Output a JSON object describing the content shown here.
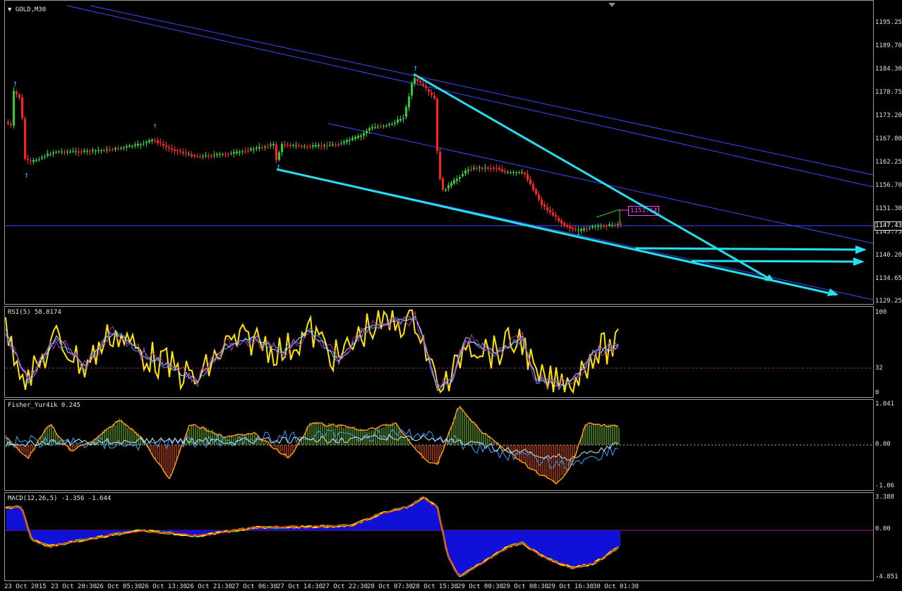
{
  "window": {
    "symbol_label": "GOLD,M30"
  },
  "colors": {
    "bull": "#2bd12b",
    "bear": "#ff2020",
    "trend": "#22e0f0",
    "channel": "#3a4cff",
    "rsi": "#ffe600",
    "magenta": "#ff40ff"
  },
  "main_pane": {
    "price_ticks": [
      "1195.25",
      "1189.70",
      "1184.30",
      "1178.75",
      "1173.20",
      "1167.80",
      "1162.25",
      "1156.70",
      "1151.30",
      "1145.75",
      "1140.20",
      "1134.65",
      "1129.25"
    ],
    "current_price": "1147.43",
    "price_tag": "1151.14"
  },
  "rsi_pane": {
    "label": "RSI(5) 58.8174",
    "ticks": [
      "100",
      "32",
      "0"
    ]
  },
  "fisher_pane": {
    "label": "Fisher_Yur4ik 0.245",
    "ticks": [
      "1.041",
      "0.00",
      "-1.06"
    ]
  },
  "macd_pane": {
    "label": "MACD(12,26,5) -1.356 -1.644",
    "ticks": [
      "3.388",
      "0.00",
      "-4.851"
    ]
  },
  "time_axis": [
    "23 Oct 2015",
    "23 Oct 20:30",
    "26 Oct 05:30",
    "26 Oct 13:30",
    "26 Oct 21:30",
    "27 Oct 06:30",
    "27 Oct 14:30",
    "27 Oct 22:30",
    "28 Oct 07:30",
    "28 Oct 15:30",
    "29 Oct 00:30",
    "29 Oct 08:30",
    "29 Oct 16:30",
    "30 Oct 01:30"
  ]
}
